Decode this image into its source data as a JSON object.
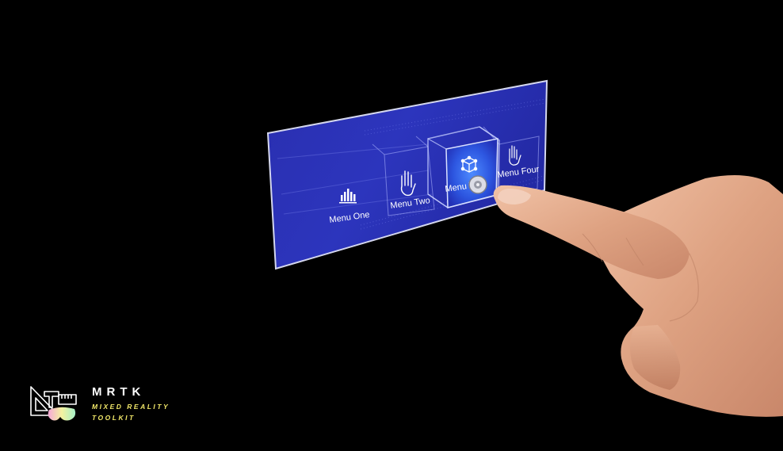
{
  "menu": {
    "items": [
      {
        "label": "Menu One",
        "icon": "bar-chart-icon"
      },
      {
        "label": "Menu Two",
        "icon": "hand-icon"
      },
      {
        "label": "Menu Th",
        "icon": "cube-network-icon",
        "state": "pressed"
      },
      {
        "label": "Menu Four",
        "icon": "hand-outline-icon"
      }
    ]
  },
  "logo": {
    "title": "MRTK",
    "subtitle_line1": "MIXED REALITY",
    "subtitle_line2": "TOOLKIT"
  },
  "colors": {
    "background": "#000000",
    "panel": "#2d34b8",
    "panel_dark": "#1f2590",
    "panel_border": "#c9cde8",
    "highlight": "#3a7bff",
    "logo_accent": "#f3e96a",
    "finger": "#e0a98a"
  }
}
